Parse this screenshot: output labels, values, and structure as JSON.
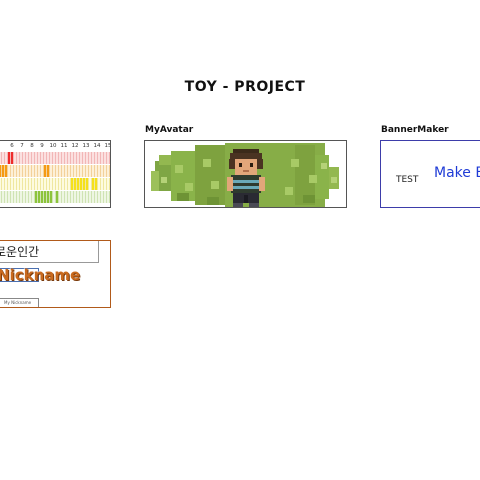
{
  "page": {
    "title": "TOY - PROJECT"
  },
  "cards": {
    "grid": {
      "title": "",
      "header_numbers": [
        "6",
        "7",
        "8",
        "9",
        "10",
        "11",
        "12",
        "13",
        "14",
        "15"
      ]
    },
    "avatar": {
      "title": "MyAvatar"
    },
    "banner": {
      "title": "BannerMaker",
      "test_text": "TEST",
      "make_text": "Make B"
    },
    "nickname": {
      "top_text": "로운인간",
      "nickname_text": "Nickname",
      "input_text": "My Nickname"
    }
  },
  "colors": {
    "accent_red": "#ee2b2b",
    "accent_orange": "#f59a12",
    "accent_yellow": "#f5e11a",
    "accent_green": "#8cc43c",
    "banner_blue": "#1f3bd6",
    "nickname_orange": "#c96a1e"
  }
}
